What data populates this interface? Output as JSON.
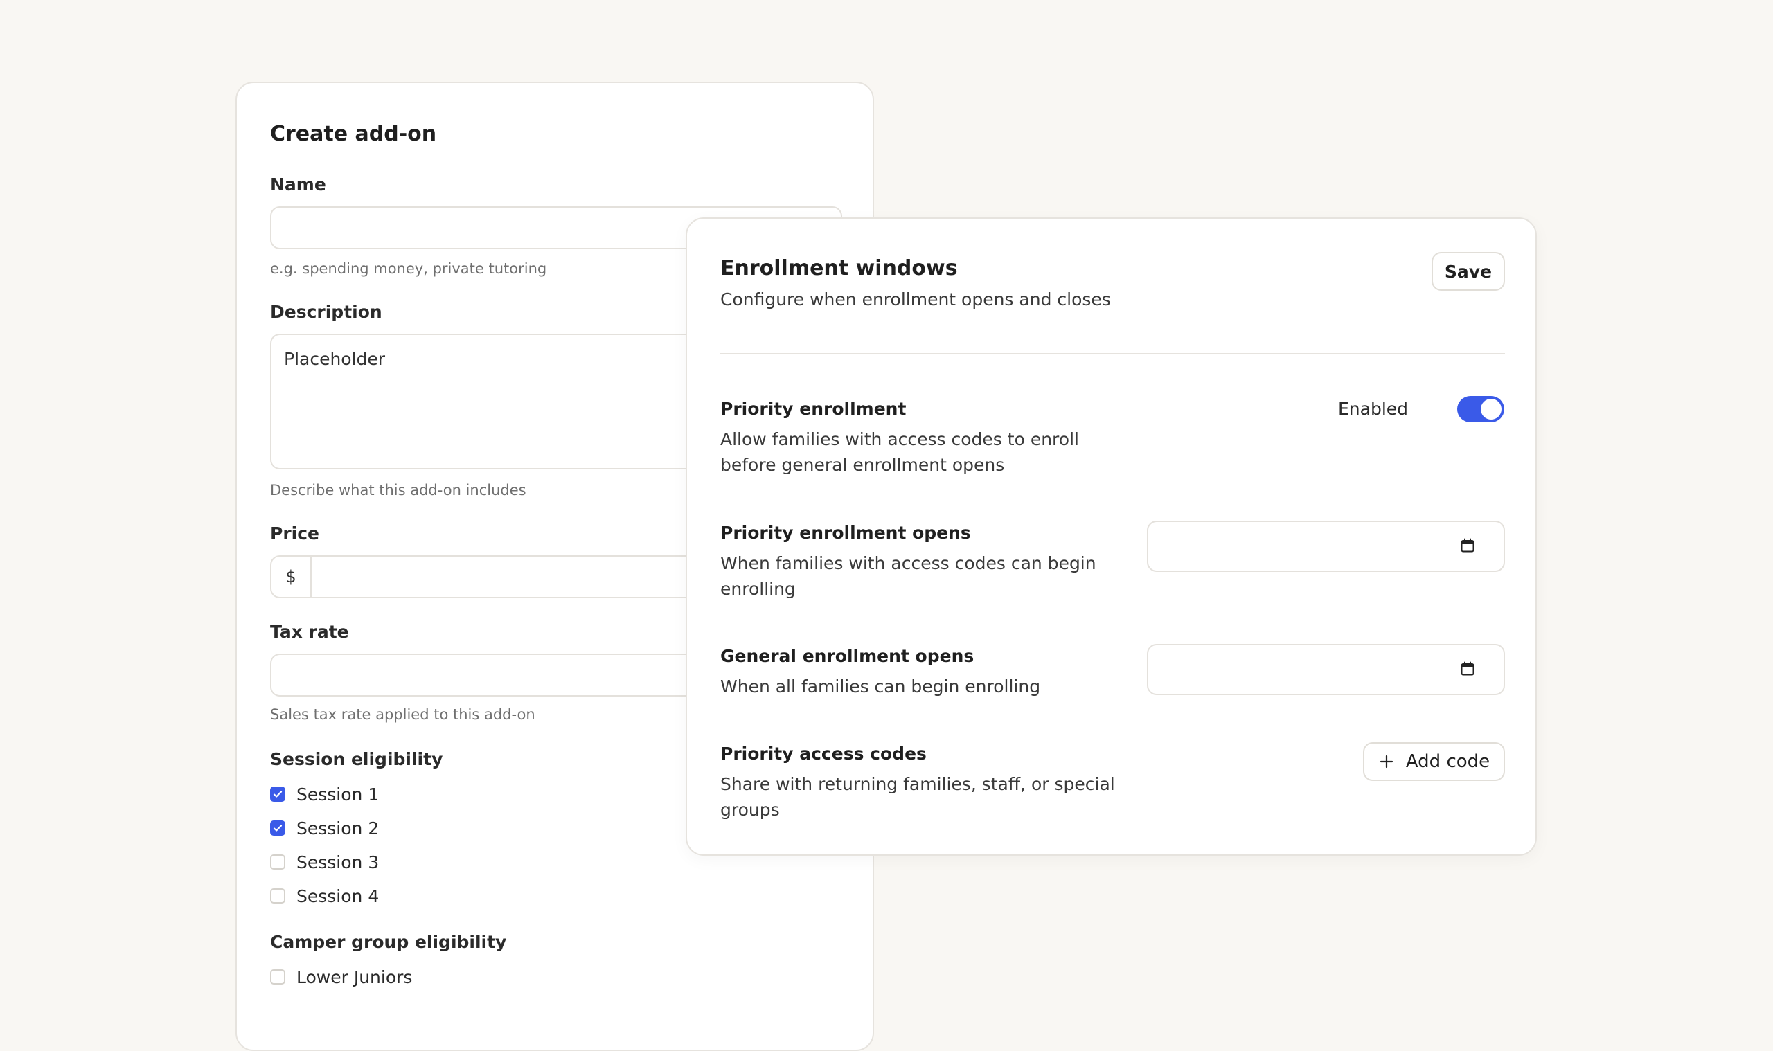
{
  "addon": {
    "title": "Create add-on",
    "name_label": "Name",
    "name_help": "e.g. spending money, private tutoring",
    "description_label": "Description",
    "description_value": "Placeholder",
    "description_help": "Describe what this add-on includes",
    "price_label": "Price",
    "price_prefix": "$",
    "tax_label": "Tax rate",
    "tax_help": "Sales tax rate applied to this add-on",
    "session_label": "Session eligibility",
    "sessions": [
      {
        "label": "Session 1",
        "checked": true
      },
      {
        "label": "Session 2",
        "checked": true
      },
      {
        "label": "Session 3",
        "checked": false
      },
      {
        "label": "Session 4",
        "checked": false
      }
    ],
    "group_label": "Camper group eligibility",
    "groups": [
      {
        "label": "Lower Juniors",
        "checked": false
      }
    ]
  },
  "enrollment": {
    "title": "Enrollment windows",
    "subtitle": "Configure when enrollment opens and closes",
    "save_label": "Save",
    "priority": {
      "title": "Priority enrollment",
      "desc_line1": "Allow families with access codes to enroll",
      "desc_line2": "before general enrollment opens",
      "toggle_label": "Enabled",
      "enabled": true
    },
    "priority_opens": {
      "title": "Priority enrollment opens",
      "desc_line1": "When families with access codes can begin",
      "desc_line2": "enrolling"
    },
    "general_opens": {
      "title": "General enrollment opens",
      "desc_line1": "When all families can begin enrolling"
    },
    "access_codes": {
      "title": "Priority access codes",
      "desc_line1": "Share with returning families, staff, or special",
      "desc_line2": "groups",
      "add_label": "Add code"
    }
  },
  "colors": {
    "accent": "#3a5ae8",
    "background": "#f9f7f3",
    "border": "#e6e3de"
  },
  "icons": {
    "calendar": "calendar-icon",
    "plus": "plus-icon",
    "check": "check-icon"
  }
}
